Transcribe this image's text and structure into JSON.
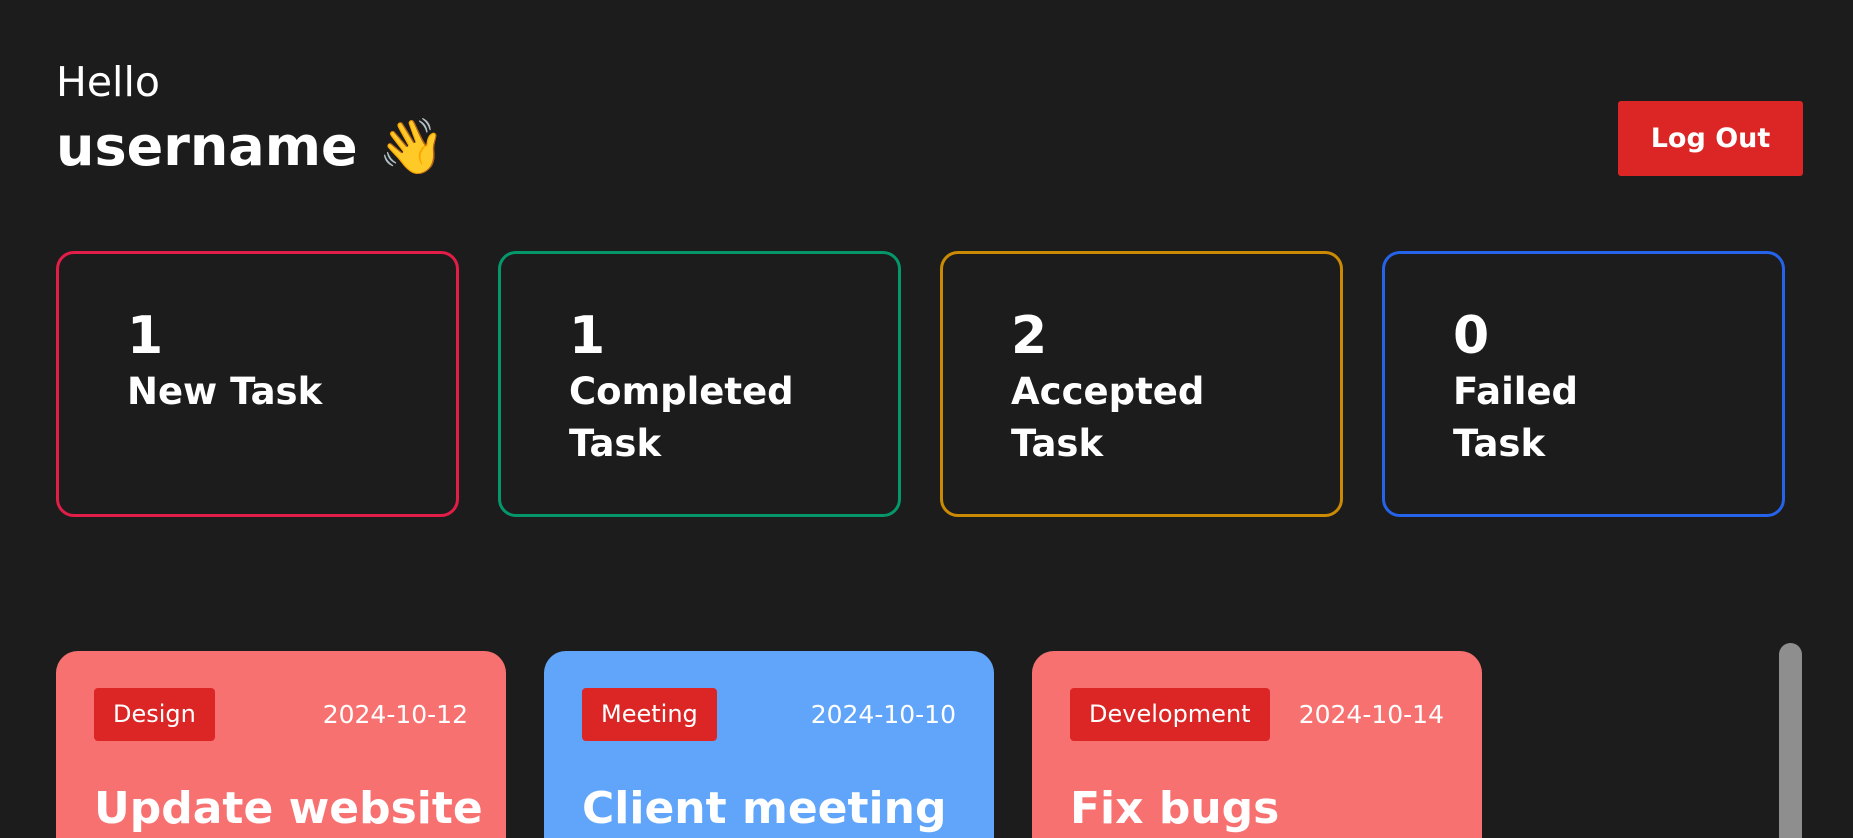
{
  "header": {
    "greeting": "Hello",
    "username": "username",
    "wave_icon": "waving-hand-icon",
    "wave_emoji": "👋"
  },
  "actions": {
    "logout_label": "Log Out"
  },
  "stats": [
    {
      "count": "1",
      "label": "New Task",
      "color": "#e11d48"
    },
    {
      "count": "1",
      "label": "Completed Task",
      "color": "#059669"
    },
    {
      "count": "2",
      "label": "Accepted Task",
      "color": "#ca8a04"
    },
    {
      "count": "0",
      "label": "Failed Task",
      "color": "#2563eb"
    }
  ],
  "tasks": [
    {
      "category": "Design",
      "date": "2024-10-12",
      "title": "Update website",
      "color": "#f87171"
    },
    {
      "category": "Meeting",
      "date": "2024-10-10",
      "title": "Client meeting",
      "color": "#60a5fa"
    },
    {
      "category": "Development",
      "date": "2024-10-14",
      "title": "Fix bugs",
      "color": "#f87171"
    }
  ]
}
